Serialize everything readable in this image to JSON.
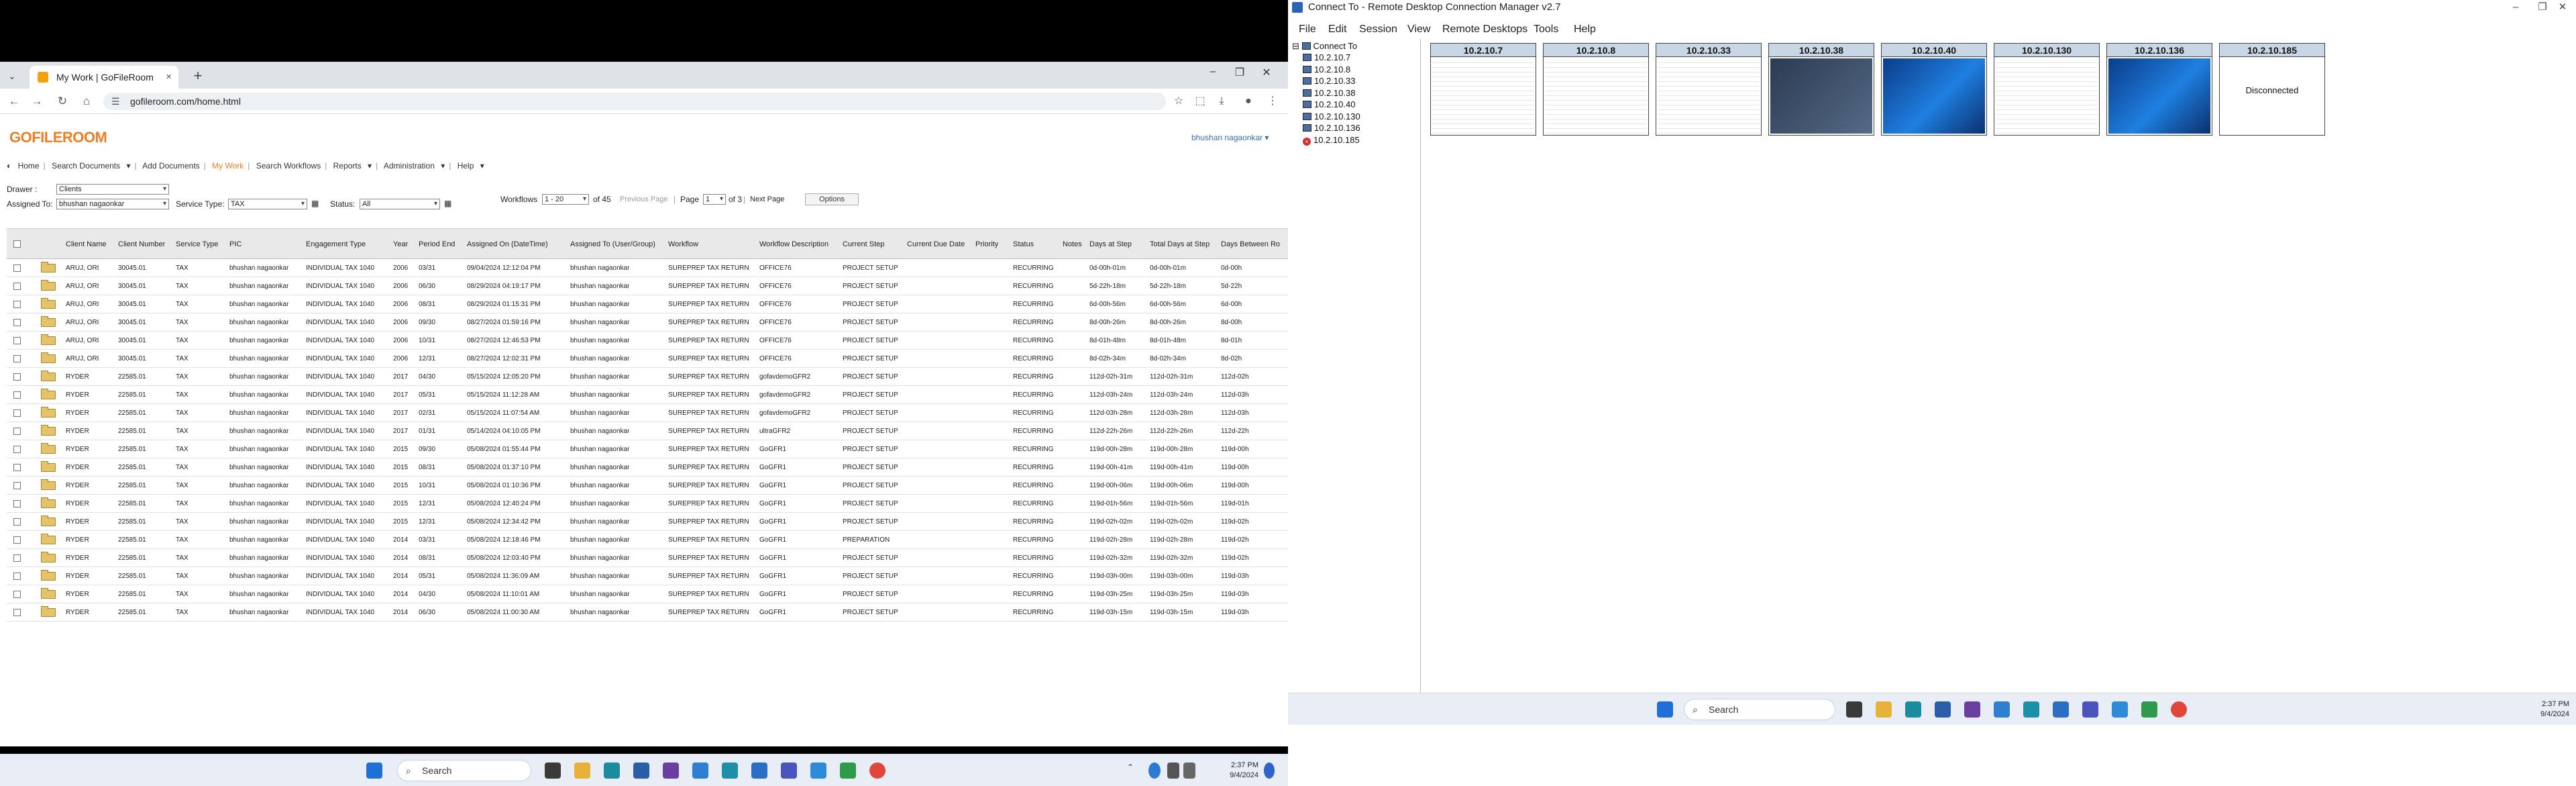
{
  "browser": {
    "tab_title": "My Work | GoFileRoom",
    "url": "gofileroom.com/home.html"
  },
  "app": {
    "logo": "GOFILEROOM",
    "user": "bhushan nagaonkar",
    "menu": [
      "Home",
      "Search Documents",
      "Add Documents",
      "My Work",
      "Search Workflows",
      "Reports",
      "Administration",
      "Help"
    ],
    "filters": {
      "drawer_label": "Drawer :",
      "drawer_value": "Clients",
      "assigned_to_label": "Assigned To:",
      "assigned_to_value": "bhushan nagaonkar",
      "service_type_label": "Service Type:",
      "service_type_value": "TAX",
      "status_label": "Status:",
      "status_value": "All",
      "workflows_label": "Workflows",
      "workflows_range": "1 - 20",
      "of_total": "of 45",
      "previous_page": "Previous Page",
      "page_label": "Page",
      "page_value": "1",
      "of_pages": "of 3",
      "next_page": "Next Page",
      "options": "Options"
    },
    "columns": [
      "Client Name",
      "Client Number",
      "Service Type",
      "PIC",
      "Engagement Type",
      "Year",
      "Period End",
      "Assigned On (DateTime)",
      "Assigned To (User/Group)",
      "Workflow",
      "Workflow Description",
      "Current Step",
      "Current Due Date",
      "Priority",
      "Status",
      "Notes",
      "Days at Step",
      "Total Days at Step",
      "Days Between Ro"
    ],
    "rows": [
      [
        "ARUJ, ORI",
        "30045.01",
        "TAX",
        "bhushan nagaonkar",
        "INDIVIDUAL TAX 1040",
        "2006",
        "03/31",
        "09/04/2024 12:12:04 PM",
        "bhushan nagaonkar",
        "SUREPREP TAX RETURN",
        "OFFICE76",
        "PROJECT SETUP",
        "",
        "",
        "RECURRING",
        "",
        "0d-00h-01m",
        "0d-00h-01m",
        "0d-00h"
      ],
      [
        "ARUJ, ORI",
        "30045.01",
        "TAX",
        "bhushan nagaonkar",
        "INDIVIDUAL TAX 1040",
        "2006",
        "06/30",
        "08/29/2024 04:19:17 PM",
        "bhushan nagaonkar",
        "SUREPREP TAX RETURN",
        "OFFICE76",
        "PROJECT SETUP",
        "",
        "",
        "RECURRING",
        "",
        "5d-22h-18m",
        "5d-22h-18m",
        "5d-22h"
      ],
      [
        "ARUJ, ORI",
        "30045.01",
        "TAX",
        "bhushan nagaonkar",
        "INDIVIDUAL TAX 1040",
        "2006",
        "08/31",
        "08/29/2024 01:15:31 PM",
        "bhushan nagaonkar",
        "SUREPREP TAX RETURN",
        "OFFICE76",
        "PROJECT SETUP",
        "",
        "",
        "RECURRING",
        "",
        "6d-00h-56m",
        "6d-00h-56m",
        "6d-00h"
      ],
      [
        "ARUJ, ORI",
        "30045.01",
        "TAX",
        "bhushan nagaonkar",
        "INDIVIDUAL TAX 1040",
        "2006",
        "09/30",
        "08/27/2024 01:59:16 PM",
        "bhushan nagaonkar",
        "SUREPREP TAX RETURN",
        "OFFICE76",
        "PROJECT SETUP",
        "",
        "",
        "RECURRING",
        "",
        "8d-00h-26m",
        "8d-00h-26m",
        "8d-00h"
      ],
      [
        "ARUJ, ORI",
        "30045.01",
        "TAX",
        "bhushan nagaonkar",
        "INDIVIDUAL TAX 1040",
        "2006",
        "10/31",
        "08/27/2024 12:46:53 PM",
        "bhushan nagaonkar",
        "SUREPREP TAX RETURN",
        "OFFICE76",
        "PROJECT SETUP",
        "",
        "",
        "RECURRING",
        "",
        "8d-01h-48m",
        "8d-01h-48m",
        "8d-01h"
      ],
      [
        "ARUJ, ORI",
        "30045.01",
        "TAX",
        "bhushan nagaonkar",
        "INDIVIDUAL TAX 1040",
        "2006",
        "12/31",
        "08/27/2024 12:02:31 PM",
        "bhushan nagaonkar",
        "SUREPREP TAX RETURN",
        "OFFICE76",
        "PROJECT SETUP",
        "",
        "",
        "RECURRING",
        "",
        "8d-02h-34m",
        "8d-02h-34m",
        "8d-02h"
      ],
      [
        "RYDER",
        "22585.01",
        "TAX",
        "bhushan nagaonkar",
        "INDIVIDUAL TAX 1040",
        "2017",
        "04/30",
        "05/15/2024 12:05:20 PM",
        "bhushan nagaonkar",
        "SUREPREP TAX RETURN",
        "gofavdemoGFR2",
        "PROJECT SETUP",
        "",
        "",
        "RECURRING",
        "",
        "112d-02h-31m",
        "112d-02h-31m",
        "112d-02h"
      ],
      [
        "RYDER",
        "22585.01",
        "TAX",
        "bhushan nagaonkar",
        "INDIVIDUAL TAX 1040",
        "2017",
        "05/31",
        "05/15/2024 11:12:28 AM",
        "bhushan nagaonkar",
        "SUREPREP TAX RETURN",
        "gofavdemoGFR2",
        "PROJECT SETUP",
        "",
        "",
        "RECURRING",
        "",
        "112d-03h-24m",
        "112d-03h-24m",
        "112d-03h"
      ],
      [
        "RYDER",
        "22585.01",
        "TAX",
        "bhushan nagaonkar",
        "INDIVIDUAL TAX 1040",
        "2017",
        "02/31",
        "05/15/2024 11:07:54 AM",
        "bhushan nagaonkar",
        "SUREPREP TAX RETURN",
        "gofavdemoGFR2",
        "PROJECT SETUP",
        "",
        "",
        "RECURRING",
        "",
        "112d-03h-28m",
        "112d-03h-28m",
        "112d-03h"
      ],
      [
        "RYDER",
        "22585.01",
        "TAX",
        "bhushan nagaonkar",
        "INDIVIDUAL TAX 1040",
        "2017",
        "01/31",
        "05/14/2024 04:10:05 PM",
        "bhushan nagaonkar",
        "SUREPREP TAX RETURN",
        "ultraGFR2",
        "PROJECT SETUP",
        "",
        "",
        "RECURRING",
        "",
        "112d-22h-26m",
        "112d-22h-26m",
        "112d-22h"
      ],
      [
        "RYDER",
        "22585.01",
        "TAX",
        "bhushan nagaonkar",
        "INDIVIDUAL TAX 1040",
        "2015",
        "09/30",
        "05/08/2024 01:55:44 PM",
        "bhushan nagaonkar",
        "SUREPREP TAX RETURN",
        "GoGFR1",
        "PROJECT SETUP",
        "",
        "",
        "RECURRING",
        "",
        "119d-00h-28m",
        "119d-00h-28m",
        "119d-00h"
      ],
      [
        "RYDER",
        "22585.01",
        "TAX",
        "bhushan nagaonkar",
        "INDIVIDUAL TAX 1040",
        "2015",
        "08/31",
        "05/08/2024 01:37:10 PM",
        "bhushan nagaonkar",
        "SUREPREP TAX RETURN",
        "GoGFR1",
        "PROJECT SETUP",
        "",
        "",
        "RECURRING",
        "",
        "119d-00h-41m",
        "119d-00h-41m",
        "119d-00h"
      ],
      [
        "RYDER",
        "22585.01",
        "TAX",
        "bhushan nagaonkar",
        "INDIVIDUAL TAX 1040",
        "2015",
        "10/31",
        "05/08/2024 01:10:36 PM",
        "bhushan nagaonkar",
        "SUREPREP TAX RETURN",
        "GoGFR1",
        "PROJECT SETUP",
        "",
        "",
        "RECURRING",
        "",
        "119d-00h-06m",
        "119d-00h-06m",
        "119d-00h"
      ],
      [
        "RYDER",
        "22585.01",
        "TAX",
        "bhushan nagaonkar",
        "INDIVIDUAL TAX 1040",
        "2015",
        "12/31",
        "05/08/2024 12:40:24 PM",
        "bhushan nagaonkar",
        "SUREPREP TAX RETURN",
        "GoGFR1",
        "PROJECT SETUP",
        "",
        "",
        "RECURRING",
        "",
        "119d-01h-56m",
        "119d-01h-56m",
        "119d-01h"
      ],
      [
        "RYDER",
        "22585.01",
        "TAX",
        "bhushan nagaonkar",
        "INDIVIDUAL TAX 1040",
        "2015",
        "12/31",
        "05/08/2024 12:34:42 PM",
        "bhushan nagaonkar",
        "SUREPREP TAX RETURN",
        "GoGFR1",
        "PROJECT SETUP",
        "",
        "",
        "RECURRING",
        "",
        "119d-02h-02m",
        "119d-02h-02m",
        "119d-02h"
      ],
      [
        "RYDER",
        "22585.01",
        "TAX",
        "bhushan nagaonkar",
        "INDIVIDUAL TAX 1040",
        "2014",
        "03/31",
        "05/08/2024 12:18:46 PM",
        "bhushan nagaonkar",
        "SUREPREP TAX RETURN",
        "GoGFR1",
        "PREPARATION",
        "",
        "",
        "RECURRING",
        "",
        "119d-02h-28m",
        "119d-02h-28m",
        "119d-02h"
      ],
      [
        "RYDER",
        "22585.01",
        "TAX",
        "bhushan nagaonkar",
        "INDIVIDUAL TAX 1040",
        "2014",
        "08/31",
        "05/08/2024 12:03:40 PM",
        "bhushan nagaonkar",
        "SUREPREP TAX RETURN",
        "GoGFR1",
        "PROJECT SETUP",
        "",
        "",
        "RECURRING",
        "",
        "119d-02h-32m",
        "119d-02h-32m",
        "119d-02h"
      ],
      [
        "RYDER",
        "22585.01",
        "TAX",
        "bhushan nagaonkar",
        "INDIVIDUAL TAX 1040",
        "2014",
        "05/31",
        "05/08/2024 11:36:09 AM",
        "bhushan nagaonkar",
        "SUREPREP TAX RETURN",
        "GoGFR1",
        "PROJECT SETUP",
        "",
        "",
        "RECURRING",
        "",
        "119d-03h-00m",
        "119d-03h-00m",
        "119d-03h"
      ],
      [
        "RYDER",
        "22585.01",
        "TAX",
        "bhushan nagaonkar",
        "INDIVIDUAL TAX 1040",
        "2014",
        "04/30",
        "05/08/2024 11:10:01 AM",
        "bhushan nagaonkar",
        "SUREPREP TAX RETURN",
        "GoGFR1",
        "PROJECT SETUP",
        "",
        "",
        "RECURRING",
        "",
        "119d-03h-25m",
        "119d-03h-25m",
        "119d-03h"
      ],
      [
        "RYDER",
        "22585.01",
        "TAX",
        "bhushan nagaonkar",
        "INDIVIDUAL TAX 1040",
        "2014",
        "06/30",
        "05/08/2024 11:00:30 AM",
        "bhushan nagaonkar",
        "SUREPREP TAX RETURN",
        "GoGFR1",
        "PROJECT SETUP",
        "",
        "",
        "RECURRING",
        "",
        "119d-03h-15m",
        "119d-03h-15m",
        "119d-03h"
      ]
    ]
  },
  "taskbar_left": {
    "search": "Search",
    "time": "2:37 PM",
    "date": "9/4/2024"
  },
  "rdcm": {
    "title": "Connect To - Remote Desktop Connection Manager v2.7",
    "menu": [
      "File",
      "Edit",
      "Session",
      "View",
      "Remote Desktops",
      "Tools",
      "Help"
    ],
    "tree_root": "Connect To",
    "servers": [
      "10.2.10.7",
      "10.2.10.8",
      "10.2.10.33",
      "10.2.10.38",
      "10.2.10.40",
      "10.2.10.130",
      "10.2.10.136",
      "10.2.10.185"
    ],
    "thumbnails": [
      "10.2.10.7",
      "10.2.10.8",
      "10.2.10.33",
      "10.2.10.38",
      "10.2.10.40",
      "10.2.10.130",
      "10.2.10.136",
      "10.2.10.185"
    ],
    "disconnected": "Disconnected"
  },
  "taskbar_right": {
    "search": "Search",
    "time": "2:37 PM",
    "date": "9/4/2024"
  }
}
